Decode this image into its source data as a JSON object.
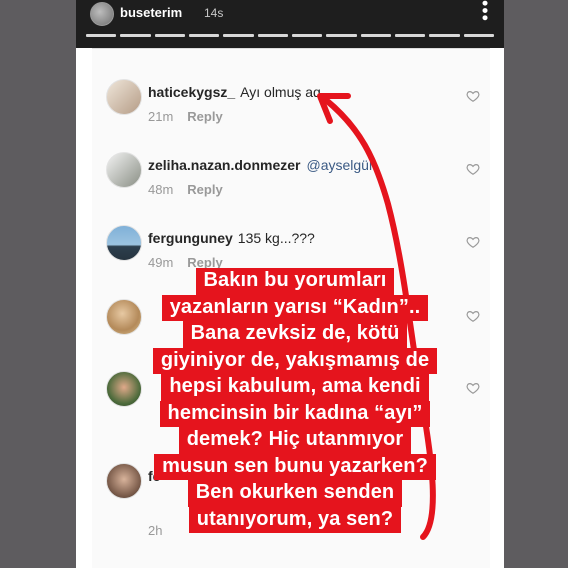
{
  "story": {
    "username": "buseterim",
    "time": "14s",
    "menu_icon": "more-dots-icon"
  },
  "comments": [
    {
      "username": "haticekygsz_",
      "text": "Ayı olmuş aq",
      "age": "21m",
      "reply": "Reply"
    },
    {
      "username": "zeliha.nazan.donmezer",
      "mention": "@ayselgül",
      "age": "48m",
      "reply": "Reply"
    },
    {
      "username": "fergunguney",
      "text": "135 kg...???",
      "age": "49m",
      "reply": "Reply"
    },
    {
      "username": "",
      "text": "",
      "age": "",
      "reply": ""
    },
    {
      "username": "",
      "text": "",
      "age": "",
      "reply": ""
    },
    {
      "username": "fe",
      "text": "",
      "age": "2h",
      "reply": ""
    }
  ],
  "overlay_lines": [
    "Bakın bu yorumları",
    "yazanların yarısı “Kadın”..",
    "Bana zevksiz de, kötü",
    "giyiniyor de, yakışmamış de",
    "hepsi kabulum, ama kendi",
    "hemcinsin bir kadına “ayı”",
    "demek? Hiç utanmıyor",
    "musun sen bunu yazarken?",
    "Ben okurken senden",
    "utanıyorum, ya sen?"
  ],
  "colors": {
    "overlay_bg": "#e5141d",
    "arrow": "#e5141d",
    "mention": "#3b5a84"
  }
}
